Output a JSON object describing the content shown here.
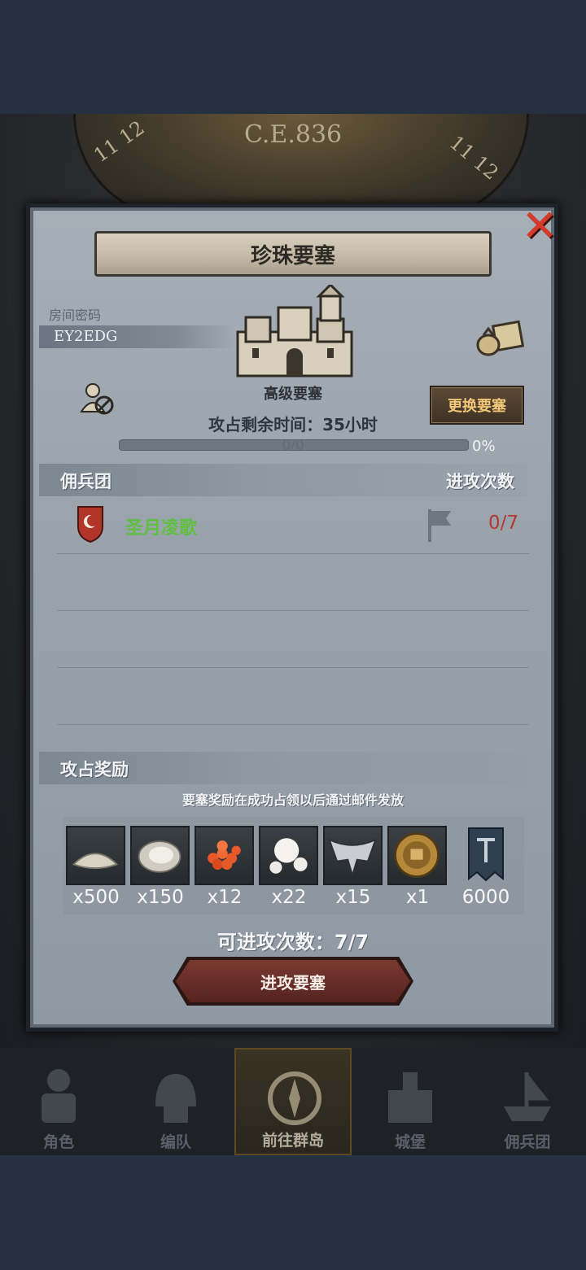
{
  "header": {
    "year": "C.E.836",
    "dial_left": "11 12",
    "dial_right": "11 12"
  },
  "dialog": {
    "title": "珍珠要塞",
    "room_label": "房间密码",
    "room_code": "EY2EDG",
    "fortress_level": "高级要塞",
    "change_button": "更换要塞",
    "occupy_time": "攻占剩余时间：35小时",
    "progress": {
      "label": "0/0",
      "percent_text": "0%",
      "fraction": 0
    },
    "mercenary_header": "佣兵团",
    "attack_count_header": "进攻次数",
    "guild": {
      "name": "圣月凌歌",
      "attacks": "0/7",
      "color": "#5fbf3f",
      "attacks_color": "#b23a2e"
    },
    "reward_header": "攻占奖励",
    "reward_note": "要塞奖励在成功占领以后通过邮件发放",
    "rewards": [
      {
        "icon": "salt-pile-icon",
        "qty": "x500"
      },
      {
        "icon": "oyster-icon",
        "qty": "x150"
      },
      {
        "icon": "roe-icon",
        "qty": "x12"
      },
      {
        "icon": "pearl-icon",
        "qty": "x22"
      },
      {
        "icon": "winged-emblem-icon",
        "qty": "x15"
      },
      {
        "icon": "knight-medal-icon",
        "qty": "x1"
      },
      {
        "icon": "guild-banner-icon",
        "qty": "6000"
      }
    ],
    "remaining_attacks": "可进攻次数：7/7",
    "attack_button": "进攻要塞"
  },
  "nav": [
    {
      "label": "角色",
      "icon": "knight-icon",
      "active": false
    },
    {
      "label": "编队",
      "icon": "helmet-icon",
      "active": false
    },
    {
      "label": "前往群岛",
      "icon": "compass-icon",
      "active": true
    },
    {
      "label": "城堡",
      "icon": "castle-icon",
      "active": false
    },
    {
      "label": "佣兵团",
      "icon": "ship-icon",
      "active": false
    }
  ]
}
